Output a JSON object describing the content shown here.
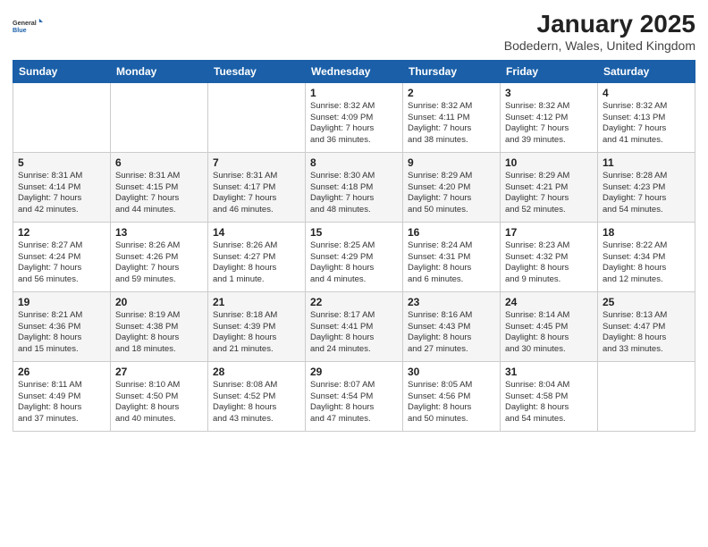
{
  "logo": {
    "text_general": "General",
    "text_blue": "Blue"
  },
  "title": "January 2025",
  "subtitle": "Bodedern, Wales, United Kingdom",
  "days_header": [
    "Sunday",
    "Monday",
    "Tuesday",
    "Wednesday",
    "Thursday",
    "Friday",
    "Saturday"
  ],
  "weeks": [
    [
      {
        "day": "",
        "info": ""
      },
      {
        "day": "",
        "info": ""
      },
      {
        "day": "",
        "info": ""
      },
      {
        "day": "1",
        "info": "Sunrise: 8:32 AM\nSunset: 4:09 PM\nDaylight: 7 hours\nand 36 minutes."
      },
      {
        "day": "2",
        "info": "Sunrise: 8:32 AM\nSunset: 4:11 PM\nDaylight: 7 hours\nand 38 minutes."
      },
      {
        "day": "3",
        "info": "Sunrise: 8:32 AM\nSunset: 4:12 PM\nDaylight: 7 hours\nand 39 minutes."
      },
      {
        "day": "4",
        "info": "Sunrise: 8:32 AM\nSunset: 4:13 PM\nDaylight: 7 hours\nand 41 minutes."
      }
    ],
    [
      {
        "day": "5",
        "info": "Sunrise: 8:31 AM\nSunset: 4:14 PM\nDaylight: 7 hours\nand 42 minutes."
      },
      {
        "day": "6",
        "info": "Sunrise: 8:31 AM\nSunset: 4:15 PM\nDaylight: 7 hours\nand 44 minutes."
      },
      {
        "day": "7",
        "info": "Sunrise: 8:31 AM\nSunset: 4:17 PM\nDaylight: 7 hours\nand 46 minutes."
      },
      {
        "day": "8",
        "info": "Sunrise: 8:30 AM\nSunset: 4:18 PM\nDaylight: 7 hours\nand 48 minutes."
      },
      {
        "day": "9",
        "info": "Sunrise: 8:29 AM\nSunset: 4:20 PM\nDaylight: 7 hours\nand 50 minutes."
      },
      {
        "day": "10",
        "info": "Sunrise: 8:29 AM\nSunset: 4:21 PM\nDaylight: 7 hours\nand 52 minutes."
      },
      {
        "day": "11",
        "info": "Sunrise: 8:28 AM\nSunset: 4:23 PM\nDaylight: 7 hours\nand 54 minutes."
      }
    ],
    [
      {
        "day": "12",
        "info": "Sunrise: 8:27 AM\nSunset: 4:24 PM\nDaylight: 7 hours\nand 56 minutes."
      },
      {
        "day": "13",
        "info": "Sunrise: 8:26 AM\nSunset: 4:26 PM\nDaylight: 7 hours\nand 59 minutes."
      },
      {
        "day": "14",
        "info": "Sunrise: 8:26 AM\nSunset: 4:27 PM\nDaylight: 8 hours\nand 1 minute."
      },
      {
        "day": "15",
        "info": "Sunrise: 8:25 AM\nSunset: 4:29 PM\nDaylight: 8 hours\nand 4 minutes."
      },
      {
        "day": "16",
        "info": "Sunrise: 8:24 AM\nSunset: 4:31 PM\nDaylight: 8 hours\nand 6 minutes."
      },
      {
        "day": "17",
        "info": "Sunrise: 8:23 AM\nSunset: 4:32 PM\nDaylight: 8 hours\nand 9 minutes."
      },
      {
        "day": "18",
        "info": "Sunrise: 8:22 AM\nSunset: 4:34 PM\nDaylight: 8 hours\nand 12 minutes."
      }
    ],
    [
      {
        "day": "19",
        "info": "Sunrise: 8:21 AM\nSunset: 4:36 PM\nDaylight: 8 hours\nand 15 minutes."
      },
      {
        "day": "20",
        "info": "Sunrise: 8:19 AM\nSunset: 4:38 PM\nDaylight: 8 hours\nand 18 minutes."
      },
      {
        "day": "21",
        "info": "Sunrise: 8:18 AM\nSunset: 4:39 PM\nDaylight: 8 hours\nand 21 minutes."
      },
      {
        "day": "22",
        "info": "Sunrise: 8:17 AM\nSunset: 4:41 PM\nDaylight: 8 hours\nand 24 minutes."
      },
      {
        "day": "23",
        "info": "Sunrise: 8:16 AM\nSunset: 4:43 PM\nDaylight: 8 hours\nand 27 minutes."
      },
      {
        "day": "24",
        "info": "Sunrise: 8:14 AM\nSunset: 4:45 PM\nDaylight: 8 hours\nand 30 minutes."
      },
      {
        "day": "25",
        "info": "Sunrise: 8:13 AM\nSunset: 4:47 PM\nDaylight: 8 hours\nand 33 minutes."
      }
    ],
    [
      {
        "day": "26",
        "info": "Sunrise: 8:11 AM\nSunset: 4:49 PM\nDaylight: 8 hours\nand 37 minutes."
      },
      {
        "day": "27",
        "info": "Sunrise: 8:10 AM\nSunset: 4:50 PM\nDaylight: 8 hours\nand 40 minutes."
      },
      {
        "day": "28",
        "info": "Sunrise: 8:08 AM\nSunset: 4:52 PM\nDaylight: 8 hours\nand 43 minutes."
      },
      {
        "day": "29",
        "info": "Sunrise: 8:07 AM\nSunset: 4:54 PM\nDaylight: 8 hours\nand 47 minutes."
      },
      {
        "day": "30",
        "info": "Sunrise: 8:05 AM\nSunset: 4:56 PM\nDaylight: 8 hours\nand 50 minutes."
      },
      {
        "day": "31",
        "info": "Sunrise: 8:04 AM\nSunset: 4:58 PM\nDaylight: 8 hours\nand 54 minutes."
      },
      {
        "day": "",
        "info": ""
      }
    ]
  ]
}
